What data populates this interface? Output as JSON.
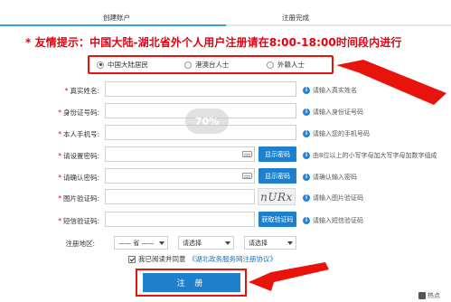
{
  "steps": {
    "step1": "创建账户",
    "step2": "注册完成",
    "progress_fraction": 0.5
  },
  "notice": "* 友情提示：中国大陆-湖北省外个人用户注册请在8:00-18:00时间段内进行",
  "identity_options": [
    {
      "label": "中国大陆居民",
      "checked": true
    },
    {
      "label": "港澳台人士",
      "checked": false
    },
    {
      "label": "外籍人士",
      "checked": false
    }
  ],
  "form": {
    "name": {
      "label": "真实姓名:",
      "hint": "请输入真实姓名"
    },
    "id_number": {
      "label": "身份证号码:",
      "hint": "请输入身份证号码"
    },
    "phone": {
      "label": "本人手机号:",
      "hint": "请输入您的手机号码"
    },
    "password": {
      "label": "请设置密码:",
      "button": "显示密码",
      "hint": "由8位以上的小写字母加大写字母加数字组成"
    },
    "password_confirm": {
      "label": "请确认密码:",
      "button": "显示密码",
      "hint": "请确认输入密码"
    },
    "captcha": {
      "label": "图片验证码:",
      "image_text": "nURx",
      "hint": "请输入图片验证码"
    },
    "sms_code": {
      "label": "短信验证码:",
      "button": "获取验证码",
      "hint": "请输入短信验证码"
    },
    "region": {
      "label": "注册地区:",
      "province": "—— 省 ——",
      "select2": "请选择",
      "select3": "请选择"
    }
  },
  "watermark": "70%",
  "agree": {
    "prefix": "我已阅读并同意",
    "link": "《湖北政务服务网注册协议》",
    "checked": true
  },
  "submit": "注 册",
  "corner_text": "热点",
  "colors": {
    "primary": "#1e7fcc",
    "alert": "#e60012",
    "annotation": "#e8140c"
  }
}
